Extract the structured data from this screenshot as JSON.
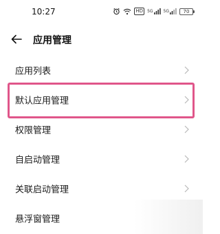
{
  "status_bar": {
    "time": "10:27",
    "icons": [
      "alarm-icon",
      "wifi-icon",
      "hd-icon",
      "signal-icon",
      "signal-icon",
      "battery-icon"
    ],
    "hd_label": "HD",
    "battery_level": "70"
  },
  "header": {
    "back_icon": "arrow-left-icon",
    "title": "应用管理"
  },
  "menu": {
    "items": [
      {
        "label": "应用列表"
      },
      {
        "label": "默认应用管理"
      },
      {
        "label": "权限管理"
      },
      {
        "label": "自启动管理"
      },
      {
        "label": "关联启动管理"
      },
      {
        "label": "悬浮窗管理"
      }
    ]
  },
  "colors": {
    "highlight": "#e0568a",
    "chevron": "#b8b8b8"
  }
}
